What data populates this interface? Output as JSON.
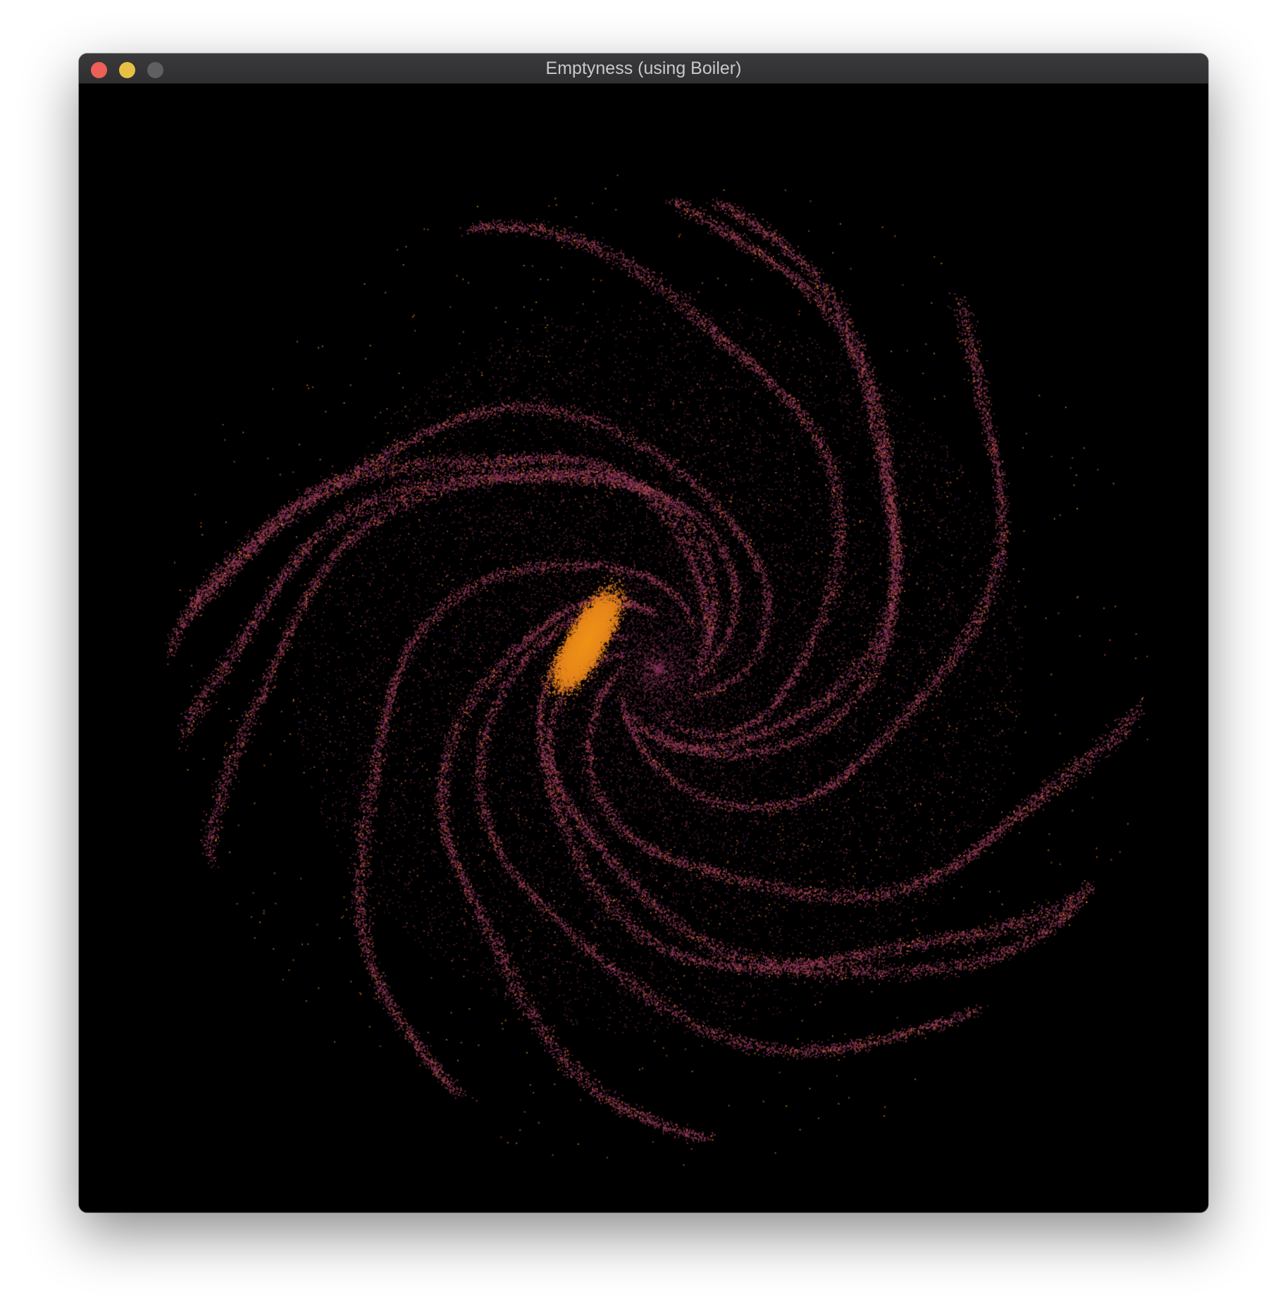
{
  "window": {
    "title": "Emptyness (using Boiler)",
    "controls": {
      "close_color": "#ee5f57",
      "minimize_color": "#e7bf45",
      "zoom_color": "#5f5f62"
    }
  },
  "visualization": {
    "type": "particle-swirl",
    "background": "#000000",
    "core_color": "#f09418",
    "mid_color": "#c4502a",
    "outer_color": "#7a2e6a",
    "arm_count": 14,
    "rotation": "counter-clockwise"
  }
}
